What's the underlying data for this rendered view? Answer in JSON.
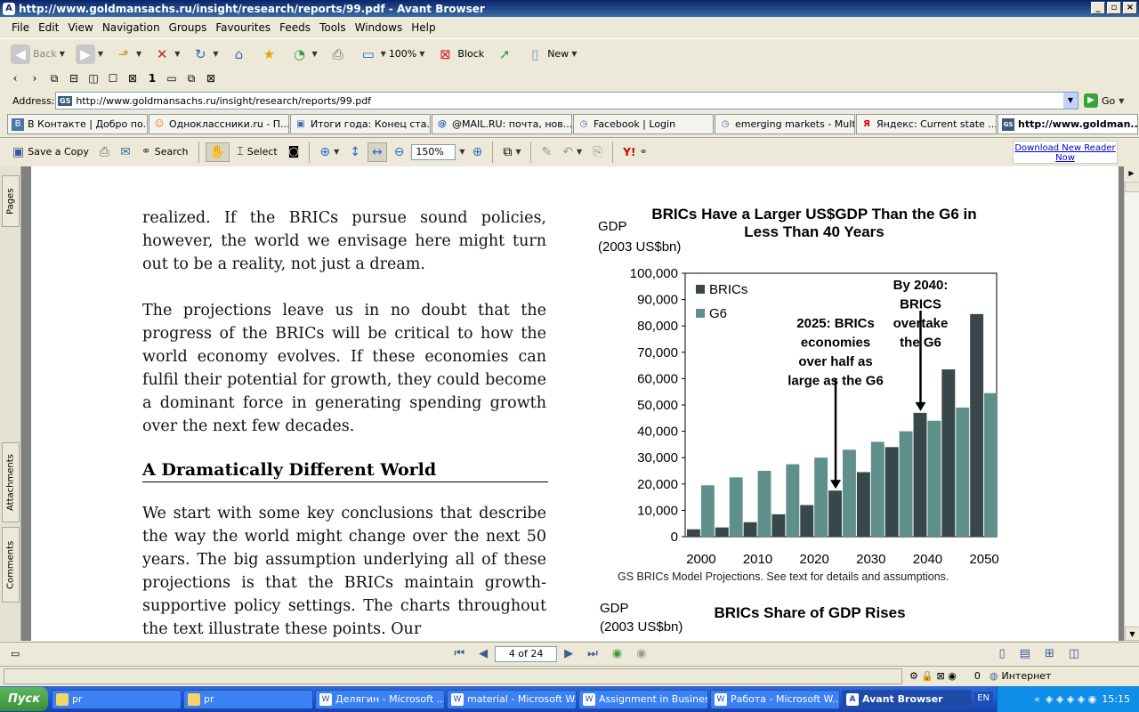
{
  "window": {
    "title": "http://www.goldmansachs.ru/insight/research/reports/99.pdf - Avant Browser"
  },
  "menu": [
    "File",
    "Edit",
    "View",
    "Navigation",
    "Groups",
    "Favourites",
    "Feeds",
    "Tools",
    "Windows",
    "Help"
  ],
  "toolbar": {
    "back": "Back",
    "zoom": "100%",
    "block": "Block",
    "new": "New"
  },
  "address": {
    "label": "Address:",
    "url": "http://www.goldmansachs.ru/insight/research/reports/99.pdf",
    "go": "Go"
  },
  "tabs": [
    {
      "label": "В Контакте | Добро по...",
      "icon": "B"
    },
    {
      "label": "Одноклассники.ru - П...",
      "icon": "ok"
    },
    {
      "label": "Итоги года: Конец ста...",
      "icon": "doc"
    },
    {
      "label": "@MAIL.RU: почта, нов...",
      "icon": "@"
    },
    {
      "label": "Facebook | Login",
      "icon": "f"
    },
    {
      "label": "emerging markets - Mult...",
      "icon": "o"
    },
    {
      "label": "Яндекс: Current state ...",
      "icon": "Я"
    },
    {
      "label": "http://www.goldman...",
      "icon": "GS"
    }
  ],
  "reader": {
    "save": "Save a Copy",
    "search": "Search",
    "select": "Select",
    "zoom": "150%",
    "download": "Download New Reader Now"
  },
  "sidepanel": {
    "pages": "Pages",
    "attachments": "Attachments",
    "comments": "Comments"
  },
  "doc": {
    "p1": "realized. If the BRICs pursue sound policies, however, the world we envisage here might turn out to be a reality, not just a dream.",
    "p2": "The projections leave us in no doubt that the progress of the BRICs will be critical to how the world economy evolves. If these economies can fulfil their potential for growth, they could become a dominant force in generating spending growth over the next few decades.",
    "heading": "A Dramatically Different World",
    "p3": "We start with some key conclusions that describe the way the world might change over the next 50 years. The big assumption underlying all of these projections is that the BRICs maintain growth-supportive policy settings. The charts throughout the text illustrate these points. Our"
  },
  "chart_data": {
    "type": "bar",
    "title": "BRICs Have a Larger US$GDP Than the G6 in Less Than 40 Years",
    "ylabel_1": "GDP",
    "ylabel_2": "(2003 US$bn)",
    "ylim": [
      0,
      100000
    ],
    "yticks": [
      "0",
      "10,000",
      "20,000",
      "30,000",
      "40,000",
      "50,000",
      "60,000",
      "70,000",
      "80,000",
      "90,000",
      "100,000"
    ],
    "xticks": [
      "2000",
      "2010",
      "2020",
      "2030",
      "2040",
      "2050"
    ],
    "categories": [
      2000,
      2005,
      2010,
      2015,
      2020,
      2025,
      2030,
      2035,
      2040,
      2045,
      2050
    ],
    "series": [
      {
        "name": "BRICs",
        "color": "#37474a",
        "values": [
          2800,
          3500,
          5500,
          8500,
          12000,
          17500,
          24500,
          34000,
          47000,
          63500,
          84500
        ]
      },
      {
        "name": "G6",
        "color": "#5f8f8a",
        "values": [
          19500,
          22500,
          25000,
          27500,
          30000,
          33000,
          36000,
          40000,
          44000,
          49000,
          54500
        ]
      }
    ],
    "annotations": [
      {
        "text": [
          "2025: BRICs",
          "economies",
          "over half as",
          "large as the G6"
        ],
        "category": 2025
      },
      {
        "text": [
          "By 2040:",
          "BRICS",
          "overtake",
          "the G6"
        ],
        "category": 2040
      }
    ],
    "note": "GS BRICs Model Projections. See text for details and assumptions."
  },
  "chart2": {
    "ylabel_1": "GDP",
    "ylabel_2": "(2003 US$bn)",
    "title": "BRICs Share of GDP Rises"
  },
  "nav": {
    "page": "4 of 24"
  },
  "status": {
    "count": "0",
    "zone": "Интернет"
  },
  "taskbar": {
    "start": "Пуск",
    "tasks": [
      "pr",
      "pr",
      "Делягин - Microsoft ...",
      "material - Microsoft W...",
      "Assignment in Business...",
      "Работа - Microsoft W...",
      "Avant Browser"
    ],
    "lang": "EN",
    "clock": "15:15"
  }
}
